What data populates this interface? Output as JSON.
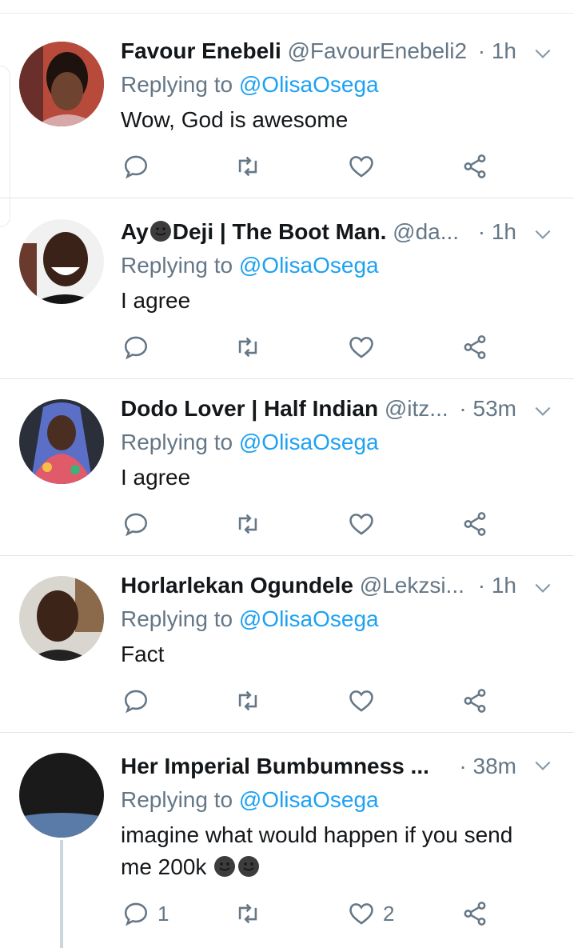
{
  "tweets": [
    {
      "name": "Favour Enebeli",
      "handle": "@FavourEnebeli2",
      "time": "· 1h",
      "replying_prefix": "Replying to ",
      "replying_to": "@OlisaOsega",
      "text": "Wow, God is awesome",
      "reply_count": "",
      "like_count": ""
    },
    {
      "name_part1": "Ay",
      "name_part2": "Deji | The Boot Man.",
      "handle": "@da...",
      "time": "· 1h",
      "replying_prefix": "Replying to ",
      "replying_to": "@OlisaOsega",
      "text": "I agree",
      "reply_count": "",
      "like_count": ""
    },
    {
      "name": "Dodo Lover | Half Indian",
      "handle": "@itz...",
      "time": "· 53m",
      "replying_prefix": "Replying to ",
      "replying_to": "@OlisaOsega",
      "text": "I agree",
      "reply_count": "",
      "like_count": ""
    },
    {
      "name": "Horlarlekan Ogundele",
      "handle": "@Lekzsi...",
      "time": "· 1h",
      "replying_prefix": "Replying to ",
      "replying_to": "@OlisaOsega",
      "text": "Fact",
      "reply_count": "",
      "like_count": ""
    },
    {
      "name": "Her Imperial Bumbumness ...",
      "handle": "",
      "time": "· 38m",
      "replying_prefix": "Replying to ",
      "replying_to": "@OlisaOsega",
      "text_line1": "imagine what would happen if you send",
      "text_line2": "me 200k",
      "reply_count": "1",
      "like_count": "2"
    }
  ],
  "icons": {
    "reply": "reply-icon",
    "retweet": "retweet-icon",
    "like": "heart-icon",
    "share": "share-icon",
    "menu": "chevron-down-icon"
  },
  "colors": {
    "link": "#1da1f2",
    "muted": "#657786",
    "text": "#14171a",
    "divider": "#dfe5ea"
  }
}
